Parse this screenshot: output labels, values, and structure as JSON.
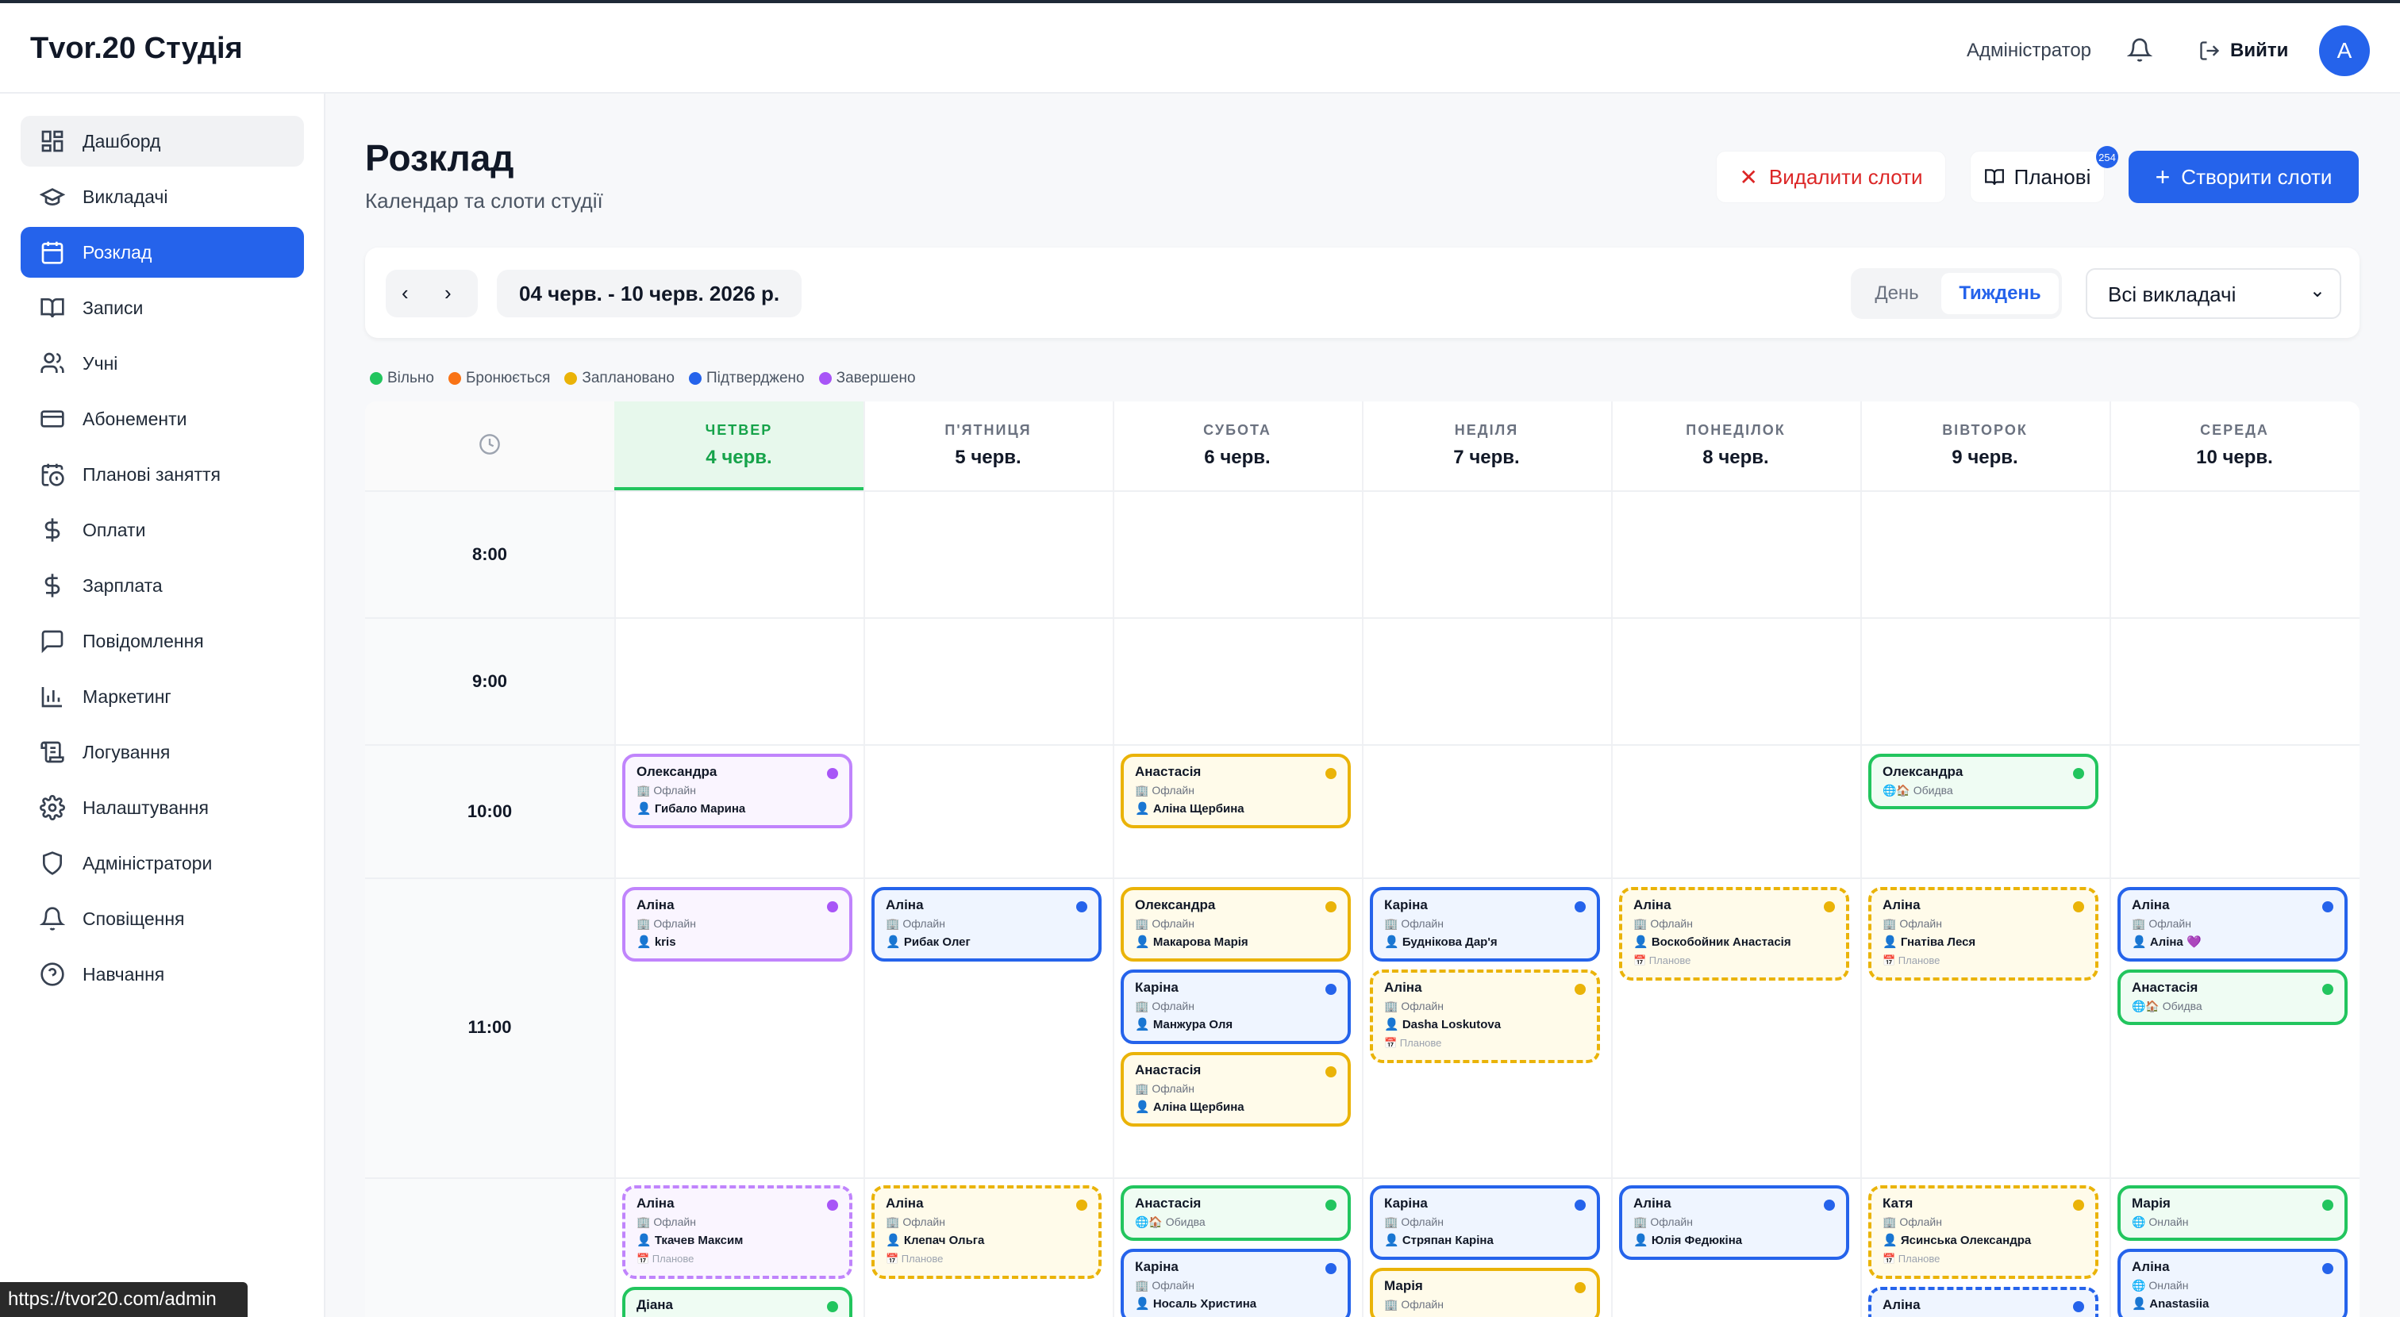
{
  "app": {
    "brand": "Tvor.20 Студія",
    "role": "Адміністратор",
    "logout": "Вийти",
    "avatar": "A"
  },
  "sidebar": {
    "items": [
      {
        "label": "Дашборд"
      },
      {
        "label": "Викладачі"
      },
      {
        "label": "Розклад"
      },
      {
        "label": "Записи"
      },
      {
        "label": "Учні"
      },
      {
        "label": "Абонементи"
      },
      {
        "label": "Планові заняття"
      },
      {
        "label": "Оплати"
      },
      {
        "label": "Зарплата"
      },
      {
        "label": "Повідомлення"
      },
      {
        "label": "Маркетинг"
      },
      {
        "label": "Логування"
      },
      {
        "label": "Налаштування"
      },
      {
        "label": "Адміністратори"
      },
      {
        "label": "Сповіщення"
      },
      {
        "label": "Навчання"
      }
    ]
  },
  "page": {
    "title": "Розклад",
    "subtitle": "Календар та слоти студії",
    "delete_label": "Видалити слоти",
    "planned_label": "Планові",
    "planned_badge": "254",
    "create_label": "Створити слоти"
  },
  "toolbar": {
    "range": "04 черв. - 10 черв. 2026 р.",
    "view_day": "День",
    "view_week": "Тиждень",
    "teacher_select": "Всі викладачі"
  },
  "legend": [
    {
      "label": "Вільно",
      "color": "#22c55e"
    },
    {
      "label": "Бронюється",
      "color": "#f97316"
    },
    {
      "label": "Заплановано",
      "color": "#eab308"
    },
    {
      "label": "Підтверджено",
      "color": "#2563eb"
    },
    {
      "label": "Завершено",
      "color": "#a855f7"
    }
  ],
  "days": [
    {
      "name": "ЧЕТВЕР",
      "date": "4 черв."
    },
    {
      "name": "П'ЯТНИЦЯ",
      "date": "5 черв."
    },
    {
      "name": "СУБОТА",
      "date": "6 черв."
    },
    {
      "name": "НЕДІЛЯ",
      "date": "7 черв."
    },
    {
      "name": "ПОНЕДІЛОК",
      "date": "8 черв."
    },
    {
      "name": "ВІВТОРОК",
      "date": "9 черв."
    },
    {
      "name": "СЕРЕДА",
      "date": "10 черв."
    }
  ],
  "times": [
    "8:00",
    "9:00",
    "10:00",
    "11:00"
  ],
  "slots": [
    {
      "name": "Олександра",
      "mode": "🏢 Офлайн",
      "student": "👤 Гибало Марина"
    },
    {
      "name": "Анастасія",
      "mode": "🏢 Офлайн",
      "student": "👤 Аліна Щербина"
    },
    {
      "name": "Олександра",
      "mode": "🌐🏠 Обидва"
    },
    {
      "name": "Аліна",
      "mode": "🏢 Офлайн",
      "student": "👤 kris"
    },
    {
      "name": "Аліна",
      "mode": "🏢 Офлайн",
      "student": "👤 Рибак Олег"
    },
    {
      "name": "Олександра",
      "mode": "🏢 Офлайн",
      "student": "👤 Макарова Марія"
    },
    {
      "name": "Каріна",
      "mode": "🏢 Офлайн",
      "student": "👤 Манжура Оля"
    },
    {
      "name": "Анастасія",
      "mode": "🏢 Офлайн",
      "student": "👤 Аліна Щербина"
    },
    {
      "name": "Каріна",
      "mode": "🏢 Офлайн",
      "student": "👤 Буднікова Дар'я"
    },
    {
      "name": "Аліна",
      "mode": "🏢 Офлайн",
      "student": "👤 Dasha Loskutova",
      "plan": "📅 Планове"
    },
    {
      "name": "Аліна",
      "mode": "🏢 Офлайн",
      "student": "👤 Воскобойник Анастасія",
      "plan": "📅 Планове"
    },
    {
      "name": "Аліна",
      "mode": "🏢 Офлайн",
      "student": "👤 Гнатіва Леся",
      "plan": "📅 Планове"
    },
    {
      "name": "Аліна",
      "mode": "🏢 Офлайн",
      "student": "👤 Аліна 💜"
    },
    {
      "name": "Анастасія",
      "mode": "🌐🏠 Обидва"
    },
    {
      "name": "Аліна",
      "mode": "🏢 Офлайн",
      "student": "👤 Ткачев Максим",
      "plan": "📅 Планове"
    },
    {
      "name": "Аліна",
      "mode": "🏢 Офлайн",
      "student": "👤 Клепач Ольга",
      "plan": "📅 Планове"
    },
    {
      "name": "Анастасія",
      "mode": "🌐🏠 Обидва"
    },
    {
      "name": "Каріна",
      "mode": "🏢 Офлайн",
      "student": "👤 Носаль Христина"
    },
    {
      "name": "Каріна",
      "mode": "🏢 Офлайн",
      "student": "👤 Стряпан Каріна"
    },
    {
      "name": "Марія",
      "mode": "🏢 Офлайн"
    },
    {
      "name": "Аліна",
      "mode": "🏢 Офлайн",
      "student": "👤 Юлія Федюкіна"
    },
    {
      "name": "Катя",
      "mode": "🏢 Офлайн",
      "student": "👤 Ясинська Олександра",
      "plan": "📅 Планове"
    },
    {
      "name": "Аліна"
    },
    {
      "name": "Марія",
      "mode": "🌐 Онлайн"
    },
    {
      "name": "Аліна",
      "mode": "🌐 Онлайн",
      "student": "👤 Anastasiia"
    },
    {
      "name": "Діана"
    }
  ],
  "statusbar": "https://tvor20.com/admin"
}
